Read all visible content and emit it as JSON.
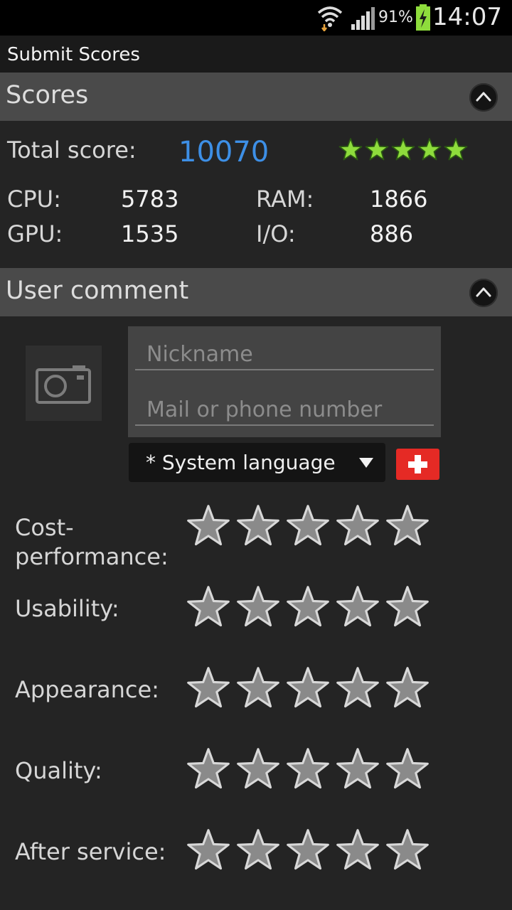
{
  "status_bar": {
    "battery": "91%",
    "time": "14:07"
  },
  "app": {
    "title": "Submit Scores"
  },
  "scores_section": {
    "header": "Scores",
    "total_label": "Total score:",
    "total_value": "10070",
    "total_stars": 5,
    "cpu_label": "CPU:",
    "cpu_value": "5783",
    "ram_label": "RAM:",
    "ram_value": "1866",
    "gpu_label": "GPU:",
    "gpu_value": "1535",
    "io_label": "I/O:",
    "io_value": "886"
  },
  "comment_section": {
    "header": "User comment",
    "nickname_placeholder": "Nickname",
    "contact_placeholder": "Mail or phone number",
    "language_selected": "* System language"
  },
  "ratings": [
    {
      "label": "Cost-\nperformance:",
      "value": 0
    },
    {
      "label": "Usability:",
      "value": 0
    },
    {
      "label": "Appearance:",
      "value": 0
    },
    {
      "label": "Quality:",
      "value": 0
    },
    {
      "label": "After service:",
      "value": 0
    }
  ],
  "colors": {
    "accent_score": "#3d8fe6",
    "star_green": "#8edc3c",
    "star_empty": "#8a8a8a",
    "flag_red": "#e52a25"
  },
  "icons": [
    "wifi-icon",
    "signal-icon",
    "battery-icon",
    "collapse-icon",
    "camera-icon",
    "dropdown-arrow-icon",
    "swiss-flag-icon",
    "star-icon"
  ]
}
